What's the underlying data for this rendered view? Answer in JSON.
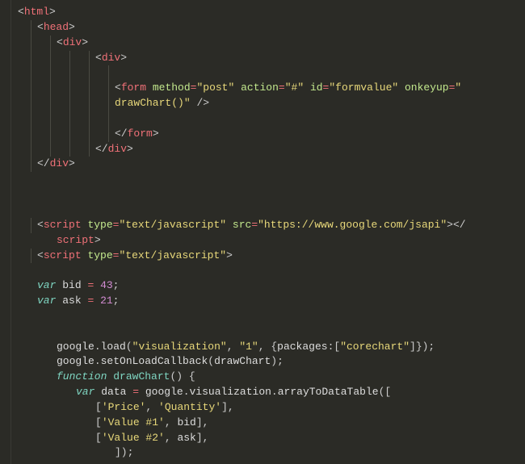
{
  "code": {
    "lines": [
      {
        "i": 0,
        "guides": [],
        "html": "<span class='bracket'>&lt;</span><span class='tag'>html</span><span class='bracket'>&gt;</span>"
      },
      {
        "i": 1,
        "guides": [
          1
        ],
        "html": "<span class='bracket'>&lt;</span><span class='tag'>head</span><span class='bracket'>&gt;</span>"
      },
      {
        "i": 2,
        "guides": [
          1,
          2
        ],
        "html": "<span class='bracket'>&lt;</span><span class='tag'>div</span><span class='bracket'>&gt;</span>"
      },
      {
        "i": 4,
        "guides": [
          1,
          2,
          3,
          4
        ],
        "html": "<span class='bracket'>&lt;</span><span class='tag'>div</span><span class='bracket'>&gt;</span>"
      },
      {
        "i": 5,
        "guides": [
          1,
          2,
          3,
          4,
          5
        ],
        "html": ""
      },
      {
        "i": 5,
        "guides": [
          1,
          2,
          3,
          4,
          5
        ],
        "html": "<span class='bracket'>&lt;</span><span class='tag'>form</span> <span class='attr'>method</span><span class='op'>=</span><span class='val'>\"post\"</span> <span class='attr'>action</span><span class='op'>=</span><span class='val'>\"#\"</span> <span class='attr'>id</span><span class='op'>=</span><span class='val'>\"formvalue\"</span> <span class='attr'>onkeyup</span><span class='op'>=</span><span class='val'>\"</span>"
      },
      {
        "i": 5,
        "guides": [
          1,
          2,
          3,
          4,
          5
        ],
        "cont": true,
        "html": "<span class='val'>drawChart()\"</span> <span class='bracket'>/&gt;</span>"
      },
      {
        "i": 5,
        "guides": [
          1,
          2,
          3,
          4,
          5
        ],
        "html": ""
      },
      {
        "i": 5,
        "guides": [
          1,
          2,
          3,
          4,
          5
        ],
        "html": "<span class='bracket'>&lt;/</span><span class='tag'>form</span><span class='bracket'>&gt;</span>"
      },
      {
        "i": 4,
        "guides": [
          1,
          2,
          3,
          4
        ],
        "html": "<span class='bracket'>&lt;/</span><span class='tag'>div</span><span class='bracket'>&gt;</span>"
      },
      {
        "i": 1,
        "guides": [
          1
        ],
        "html": "<span class='bracket'>&lt;/</span><span class='tag'>div</span><span class='bracket'>&gt;</span>"
      },
      {
        "i": 0,
        "guides": [],
        "html": ""
      },
      {
        "i": 0,
        "guides": [],
        "html": ""
      },
      {
        "i": 0,
        "guides": [],
        "html": ""
      },
      {
        "i": 1,
        "guides": [
          1
        ],
        "html": "<span class='bracket'>&lt;</span><span class='tag'>script</span> <span class='attr'>type</span><span class='op'>=</span><span class='val'>\"text/javascript\"</span> <span class='attr'>src</span><span class='op'>=</span><span class='val'>\"https://www.google.com/jsapi\"</span><span class='bracket'>&gt;&lt;/</span>"
      },
      {
        "i": 2,
        "guides": [],
        "cont": true,
        "html": "<span class='tag'>script</span><span class='bracket'>&gt;</span>"
      },
      {
        "i": 1,
        "guides": [
          1
        ],
        "html": "<span class='bracket'>&lt;</span><span class='tag'>script</span> <span class='attr'>type</span><span class='op'>=</span><span class='val'>\"text/javascript\"</span><span class='bracket'>&gt;</span>"
      },
      {
        "i": 0,
        "guides": [],
        "html": ""
      },
      {
        "i": 1,
        "guides": [],
        "html": "<span class='keyword'>var</span> <span class='ident'>bid</span> <span class='op'>=</span> <span class='num'>43</span><span class='punct'>;</span>"
      },
      {
        "i": 1,
        "guides": [],
        "html": "<span class='keyword'>var</span> <span class='ident'>ask</span> <span class='op'>=</span> <span class='num'>21</span><span class='punct'>;</span>"
      },
      {
        "i": 0,
        "guides": [],
        "html": ""
      },
      {
        "i": 0,
        "guides": [],
        "html": ""
      },
      {
        "i": 2,
        "guides": [],
        "html": "<span class='ident'>google</span><span class='punct'>.</span><span class='ident'>load</span><span class='punct'>(</span><span class='str'>\"visualization\"</span><span class='punct'>,</span> <span class='str'>\"1\"</span><span class='punct'>,</span> <span class='punct'>{</span><span class='ident'>packages</span><span class='punct'>:[</span><span class='str'>\"corechart\"</span><span class='punct'>]});</span>"
      },
      {
        "i": 2,
        "guides": [],
        "html": "<span class='ident'>google</span><span class='punct'>.</span><span class='ident'>setOnLoadCallback</span><span class='punct'>(</span><span class='ident'>drawChart</span><span class='punct'>);</span>"
      },
      {
        "i": 2,
        "guides": [],
        "html": "<span class='keyword'>function</span> <span class='func'>drawChart</span><span class='punct'>() {</span>"
      },
      {
        "i": 3,
        "guides": [],
        "html": "<span class='keyword'>var</span> <span class='ident'>data</span> <span class='op'>=</span> <span class='ident'>google</span><span class='punct'>.</span><span class='ident'>visualization</span><span class='punct'>.</span><span class='ident'>arrayToDataTable</span><span class='punct'>([</span>"
      },
      {
        "i": 4,
        "guides": [],
        "html": "<span class='punct'>[</span><span class='str'>'Price'</span><span class='punct'>,</span> <span class='str'>'Quantity'</span><span class='punct'>],</span>"
      },
      {
        "i": 4,
        "guides": [],
        "html": "<span class='punct'>[</span><span class='str'>'Value #1'</span><span class='punct'>,</span> <span class='ident'>bid</span><span class='punct'>],</span>"
      },
      {
        "i": 4,
        "guides": [],
        "html": "<span class='punct'>[</span><span class='str'>'Value #2'</span><span class='punct'>,</span> <span class='ident'>ask</span><span class='punct'>],</span>"
      },
      {
        "i": 5,
        "guides": [],
        "html": "<span class='punct'>]);</span>"
      }
    ]
  },
  "indentUnit": 24,
  "basePad": 6
}
